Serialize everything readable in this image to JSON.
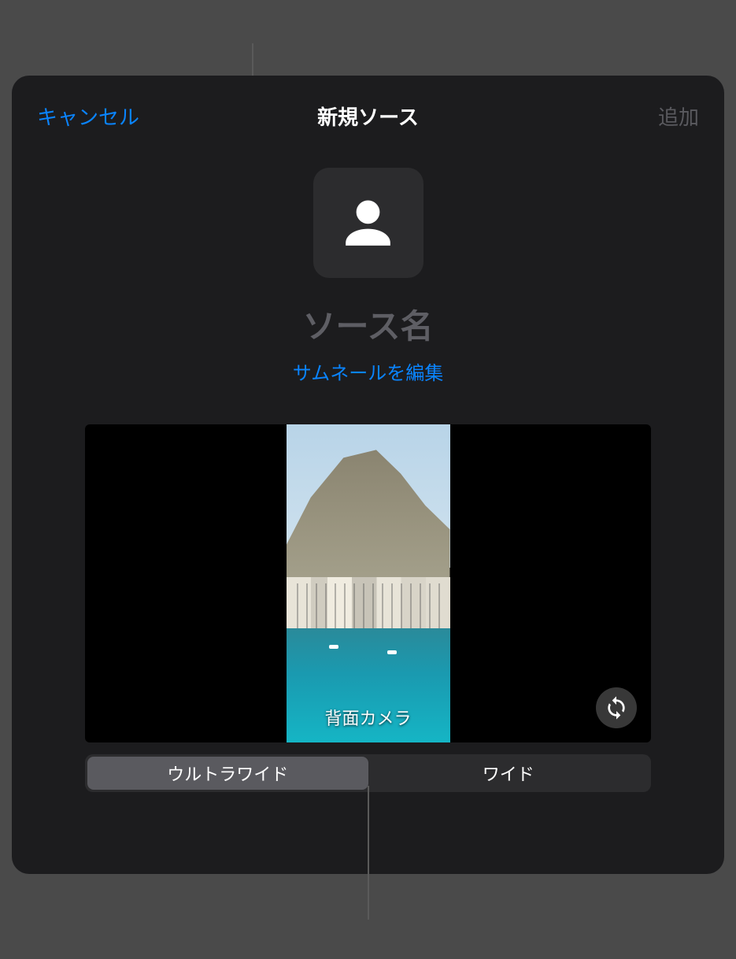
{
  "header": {
    "cancel": "キャンセル",
    "title": "新規ソース",
    "add": "追加"
  },
  "source": {
    "name_placeholder": "ソース名",
    "edit_thumbnail": "サムネールを編集"
  },
  "preview": {
    "camera_label": "背面カメラ"
  },
  "lens": {
    "options": [
      {
        "label": "ウルトラワイド",
        "selected": true
      },
      {
        "label": "ワイド",
        "selected": false
      }
    ]
  }
}
